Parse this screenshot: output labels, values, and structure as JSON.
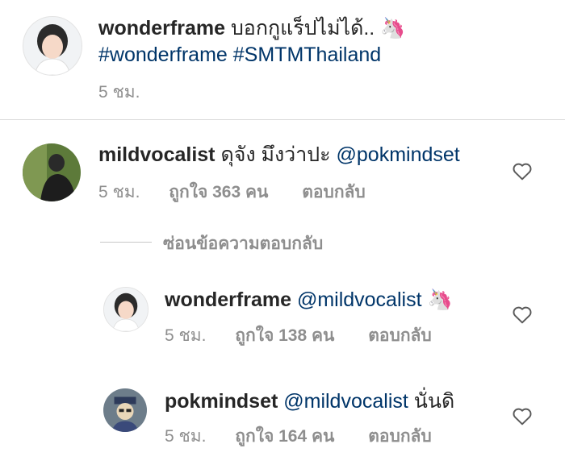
{
  "caption": {
    "username": "wonderframe",
    "text": "บอกกูแร็ปไม่ได้..",
    "emoji": "🦄",
    "hashtags": [
      "#wonderframe",
      "#SMTMThailand"
    ],
    "time": "5 ชม."
  },
  "comments": [
    {
      "username": "mildvocalist",
      "text": "ดุจัง มึงว่าปะ",
      "mention": "@pokmindset",
      "time": "5 ชม.",
      "likes": "ถูกใจ 363 คน",
      "reply": "ตอบกลับ"
    }
  ],
  "replies_toggle": "ซ่อนข้อความตอบกลับ",
  "replies": [
    {
      "username": "wonderframe",
      "mention": "@mildvocalist",
      "text": "",
      "emoji": "🦄",
      "time": "5 ชม.",
      "likes": "ถูกใจ 138 คน",
      "reply": "ตอบกลับ"
    },
    {
      "username": "pokmindset",
      "mention": "@mildvocalist",
      "text": "นั่นดิ",
      "time": "5 ชม.",
      "likes": "ถูกใจ 164 คน",
      "reply": "ตอบกลับ"
    }
  ],
  "icons": {
    "like": "heart-outline-icon"
  },
  "colors": {
    "text": "#262626",
    "secondary": "#8e8e8e",
    "link": "#003569",
    "divider": "#dbdbdb"
  }
}
